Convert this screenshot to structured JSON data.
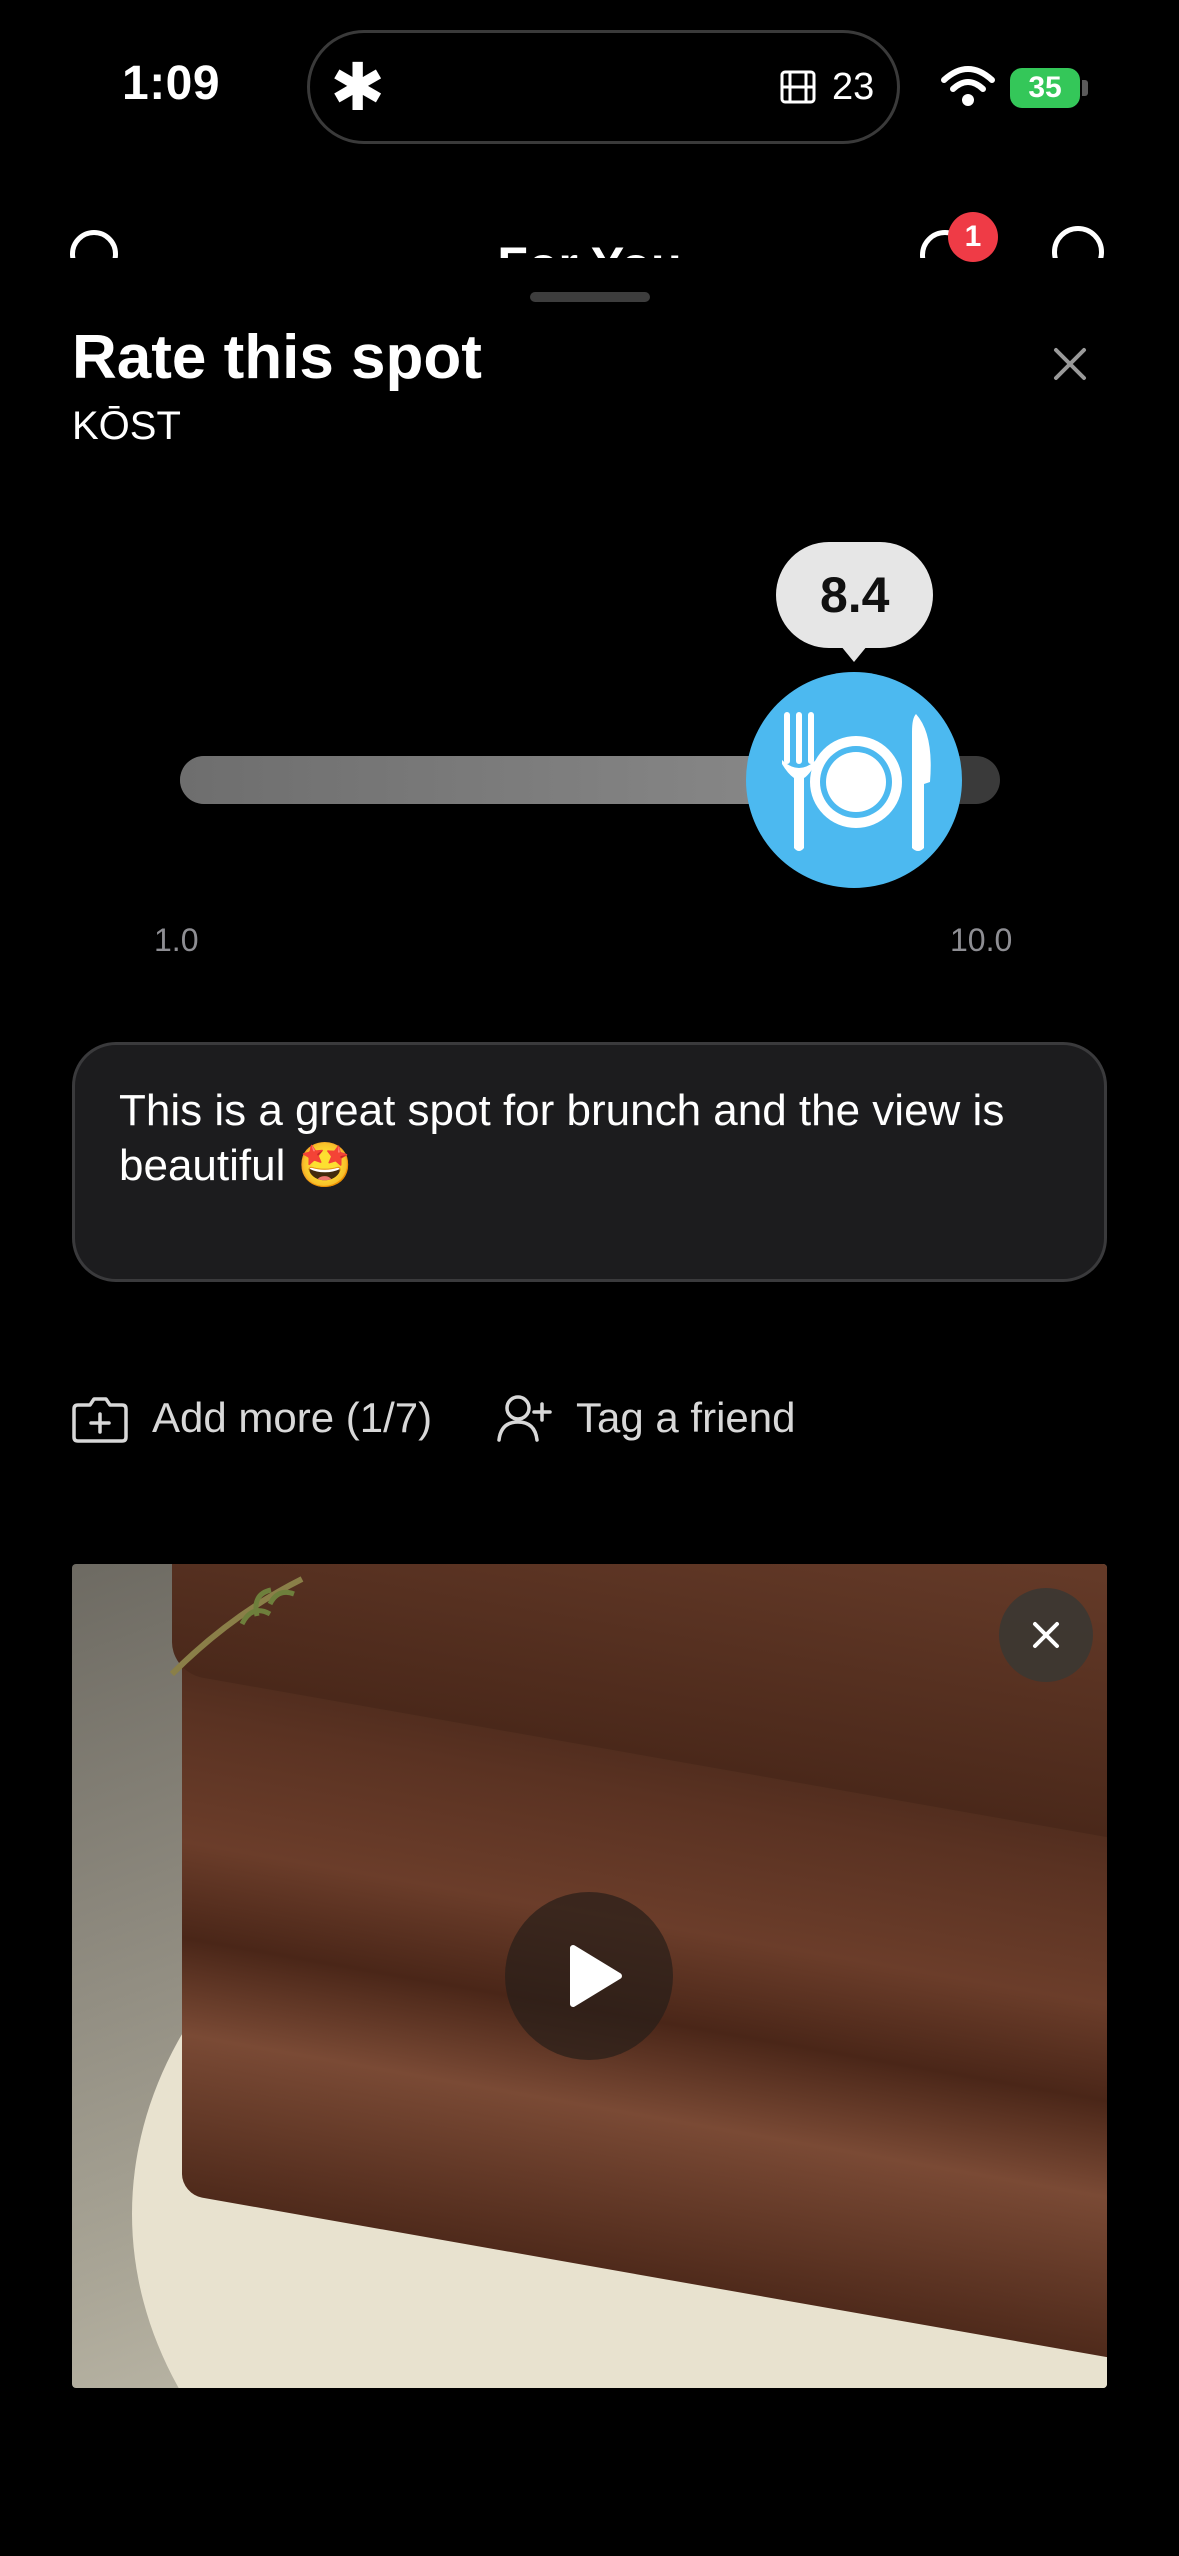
{
  "status_bar": {
    "time": "1:09",
    "island_count": "23",
    "battery": "35"
  },
  "background_header": {
    "title": "For You",
    "notification_count": "1"
  },
  "sheet": {
    "title": "Rate this spot",
    "place_name": "KŌST",
    "rating": {
      "value": "8.4",
      "min_label": "1.0",
      "max_label": "10.0",
      "min": 1.0,
      "max": 10.0,
      "current": 8.4
    },
    "review_text": "This is a great spot for brunch and the view is beautiful 🤩",
    "actions": {
      "add_more": "Add more (1/7)",
      "tag_friend": "Tag a friend"
    }
  },
  "colors": {
    "accent": "#4cb9f0",
    "badge": "#ef3b46",
    "battery": "#34c759"
  },
  "icons": [
    "asterisk-icon",
    "film-icon",
    "wifi-icon",
    "close-icon",
    "utensils-icon",
    "add-photo-icon",
    "add-person-icon",
    "play-icon"
  ]
}
